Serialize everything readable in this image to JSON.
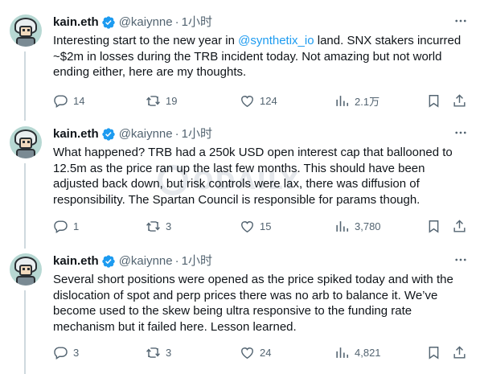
{
  "tweets": [
    {
      "name": "kain.eth",
      "handle": "@kaiynne",
      "separator": "·",
      "time": "1小时",
      "text_before": "Interesting start to the new year in ",
      "mention": "@synthetix_io",
      "text_after": " land. SNX stakers incurred ~$2m in losses during the TRB incident today. Not amazing but not world ending either, here are my thoughts.",
      "replies": "14",
      "retweets": "19",
      "likes": "124",
      "views": "2.1万"
    },
    {
      "name": "kain.eth",
      "handle": "@kaiynne",
      "separator": "·",
      "time": "1小时",
      "text": "What happened? TRB had a 250k USD open interest cap that ballooned to 12.5m as the price ran up the last few months. This should have been adjusted back down, but risk controls were lax, there was diffusion of responsibility. The Spartan Council is responsible for params though.",
      "replies": "1",
      "retweets": "3",
      "likes": "15",
      "views": "3,780"
    },
    {
      "name": "kain.eth",
      "handle": "@kaiynne",
      "separator": "·",
      "time": "1小时",
      "text": "Several short positions were opened as the price spiked today and with the dislocation of spot and perp prices there was no arb to balance it. We’ve become used to the skew being ultra responsive  to the funding rate mechanism but it failed here. Lesson learned.",
      "replies": "3",
      "retweets": "3",
      "likes": "24",
      "views": "4,821"
    }
  ],
  "watermark": "ODAILY",
  "colors": {
    "accent": "#1d9bf0",
    "muted": "#536471",
    "text": "#0f1419",
    "thread_line": "#cfd9de"
  },
  "icons": [
    "verified-badge-icon",
    "more-icon",
    "reply-icon",
    "retweet-icon",
    "like-icon",
    "views-icon",
    "bookmark-icon",
    "share-icon"
  ]
}
